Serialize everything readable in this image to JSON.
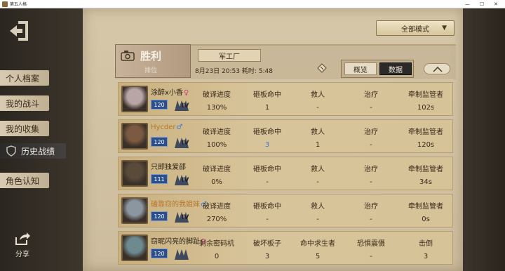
{
  "window": {
    "title": "第五人格"
  },
  "nav": {
    "items": [
      {
        "label": "个人档案",
        "active": false
      },
      {
        "label": "我的战斗",
        "active": false
      },
      {
        "label": "我的收集",
        "active": false
      },
      {
        "label": "历史战绩",
        "active": true
      },
      {
        "label": "角色认知",
        "active": false
      }
    ],
    "share_label": "分享"
  },
  "mode_select": {
    "value": "全部模式"
  },
  "match": {
    "result": "胜利",
    "rank_label": "排位",
    "map": "军工厂",
    "time": "8月23日 20:53 耗时: 5:48",
    "tabs": [
      {
        "label": "概览"
      },
      {
        "label": "数据"
      }
    ],
    "active_tab": "数据"
  },
  "survivor_columns": [
    "破译进度",
    "砸板命中",
    "救人",
    "治疗",
    "牵制监管者"
  ],
  "hunter_columns": [
    "剩余密码机",
    "破坏板子",
    "命中求生者",
    "恐惧震慑",
    "击倒"
  ],
  "players": [
    {
      "name": "涂醉x小香",
      "gender": "f",
      "level": "120",
      "tier": "IV",
      "values": [
        "130%",
        "1",
        "-",
        "-",
        "102s"
      ]
    },
    {
      "name": "Hycder",
      "gender": "m",
      "level": "120",
      "tier": "IV",
      "values": [
        "100%",
        "3",
        "1",
        "-",
        "120s"
      ]
    },
    {
      "name": "只即独爱邵",
      "gender": "",
      "level": "111",
      "tier": "IV",
      "values": [
        "0%",
        "-",
        "-",
        "-",
        "34s"
      ]
    },
    {
      "name": "磕靠窃的我姐妹",
      "gender": "m",
      "level": "120",
      "tier": "IV",
      "values": [
        "270%",
        "-",
        "-",
        "-",
        "0s"
      ]
    },
    {
      "name": "窃昵闪亮的脚趾",
      "gender": "f",
      "level": "120",
      "tier": "",
      "values": [
        "0",
        "3",
        "5",
        "-",
        "3"
      ]
    }
  ],
  "colors": {
    "accent_blue": "#3c7bd8",
    "female_pink": "#d0407a",
    "panel": "#d6c7a9"
  }
}
